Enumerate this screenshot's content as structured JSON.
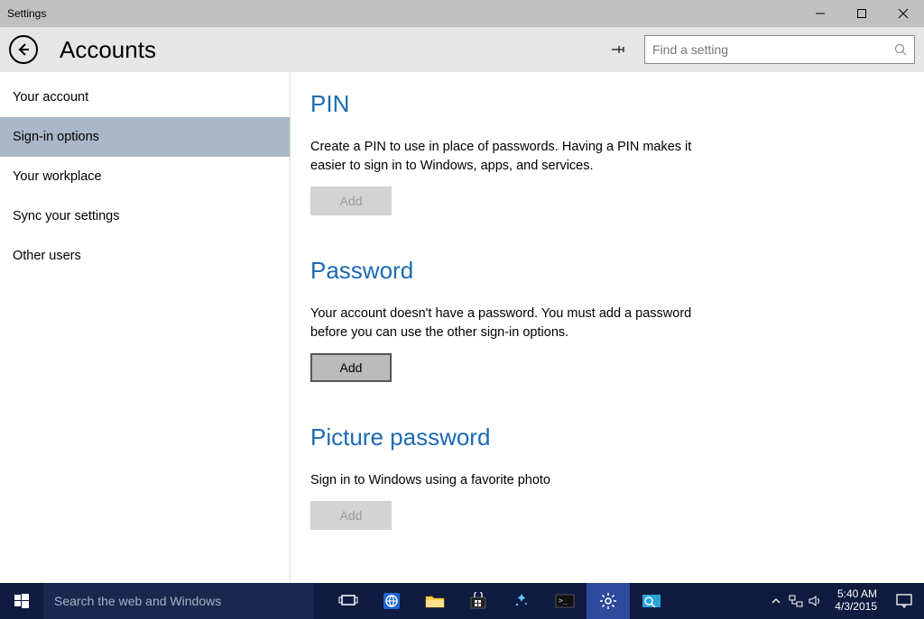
{
  "window": {
    "title": "Settings"
  },
  "header": {
    "page_title": "Accounts",
    "search_placeholder": "Find a setting"
  },
  "sidebar": {
    "items": [
      {
        "label": "Your account",
        "selected": false
      },
      {
        "label": "Sign-in options",
        "selected": true
      },
      {
        "label": "Your workplace",
        "selected": false
      },
      {
        "label": "Sync your settings",
        "selected": false
      },
      {
        "label": "Other users",
        "selected": false
      }
    ]
  },
  "sections": {
    "pin": {
      "title": "PIN",
      "body": "Create a PIN to use in place of passwords. Having a PIN makes it easier to sign in to Windows, apps, and services.",
      "button": "Add"
    },
    "password": {
      "title": "Password",
      "body": "Your account doesn't have a password. You must add a password before you can use the other sign-in options.",
      "button": "Add"
    },
    "picture": {
      "title": "Picture password",
      "body": "Sign in to Windows using a favorite photo",
      "button": "Add"
    }
  },
  "taskbar": {
    "search_placeholder": "Search the web and Windows",
    "time": "5:40 AM",
    "date": "4/3/2015"
  }
}
